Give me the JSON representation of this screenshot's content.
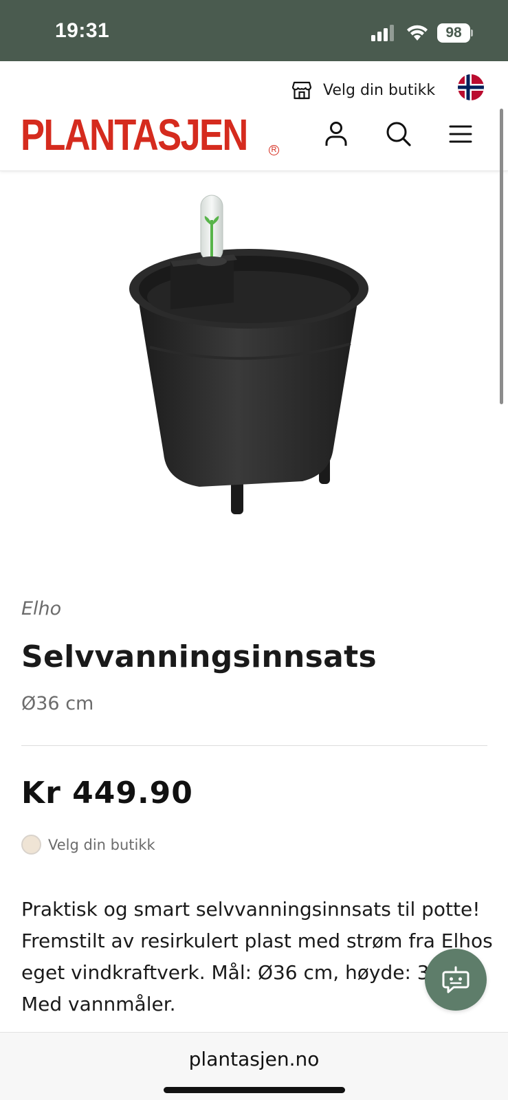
{
  "status_bar": {
    "time": "19:31",
    "battery": "98",
    "icons": [
      "signal-icon",
      "wifi-icon",
      "battery-icon"
    ]
  },
  "header": {
    "store_label": "Velg din butikk",
    "logo_text": "PLANTASJEN",
    "logo_reg": "R",
    "icons": [
      "store-icon",
      "norway-flag-icon",
      "account-icon",
      "search-icon",
      "hamburger-menu-icon"
    ],
    "brand_color": "#d52b1e"
  },
  "product": {
    "brand": "Elho",
    "title": "Selvvanningsinnsats",
    "variant": "Ø36 cm",
    "price": "Kr 449.90",
    "stock_label": "Velg din butikk",
    "description": "Praktisk og smart selvvanningsinnsats til potte! Fremstilt av resirkulert plast med strøm fra Elhos eget vindkraftverk. Mål: Ø36 cm, høyde: 35 cm. Med vannmåler."
  },
  "chat": {
    "icon": "chatbot-icon",
    "color": "#5e7d6a"
  },
  "browser": {
    "url": "plantasjen.no"
  }
}
